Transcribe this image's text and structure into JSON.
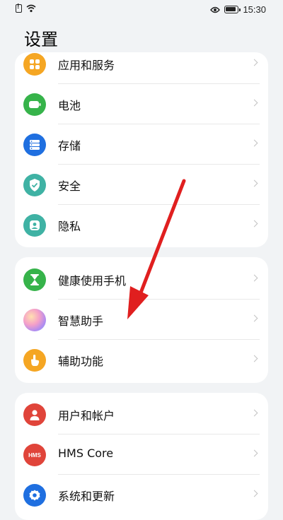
{
  "status_bar": {
    "time": "15:30"
  },
  "page": {
    "title": "设置"
  },
  "group1": {
    "items": [
      {
        "label": "应用和服务",
        "icon": "apps-icon",
        "color": "#f5a623"
      },
      {
        "label": "电池",
        "icon": "battery-icon",
        "color": "#36b34a"
      },
      {
        "label": "存储",
        "icon": "storage-icon",
        "color": "#1f6fe0"
      },
      {
        "label": "安全",
        "icon": "shield-icon",
        "color": "#3fb2a4"
      },
      {
        "label": "隐私",
        "icon": "privacy-icon",
        "color": "#3fb2a4"
      }
    ]
  },
  "group2": {
    "items": [
      {
        "label": "健康使用手机",
        "icon": "hourglass-icon",
        "color": "#36b34a"
      },
      {
        "label": "智慧助手",
        "icon": "assistant-icon",
        "color": "#c88ef0"
      },
      {
        "label": "辅助功能",
        "icon": "hand-icon",
        "color": "#f5a623"
      }
    ]
  },
  "group3": {
    "items": [
      {
        "label": "用户和帐户",
        "icon": "user-icon",
        "color": "#e0443a"
      },
      {
        "label": "HMS Core",
        "icon": "hms-icon",
        "color": "#e0443a",
        "badge": "HMS"
      },
      {
        "label": "系统和更新",
        "icon": "gear-icon",
        "color": "#1f6fe0"
      }
    ]
  },
  "annotation": {
    "color": "#e01f1f"
  }
}
